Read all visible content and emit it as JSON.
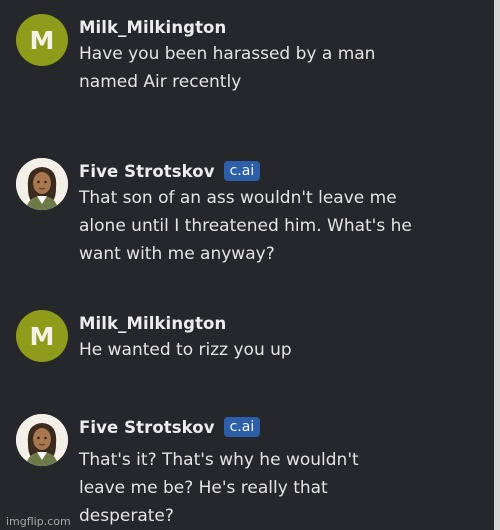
{
  "messages": [
    {
      "avatar_letter": "M",
      "author": "Milk_Milkington",
      "badge": "",
      "text": "Have you been harassed by a man\nnamed Air recently"
    },
    {
      "avatar_letter": "",
      "author": "Five Strotskov",
      "badge": "c.ai",
      "text": "That son of an ass wouldn't leave me\nalone until I threatened him. What's he\nwant with me anyway?"
    },
    {
      "avatar_letter": "M",
      "author": "Milk_Milkington",
      "badge": "",
      "text": "He wanted to rizz you up"
    },
    {
      "avatar_letter": "",
      "author": "Five Strotskov",
      "badge": "c.ai",
      "text": "That's it? That's why he wouldn't\nleave me be? He's really that\ndesperate?"
    }
  ],
  "watermark": "imgflip.com",
  "colors": {
    "background": "#26272b",
    "letter_avatar": "#8e9c1c",
    "badge": "#2d5fa8"
  }
}
